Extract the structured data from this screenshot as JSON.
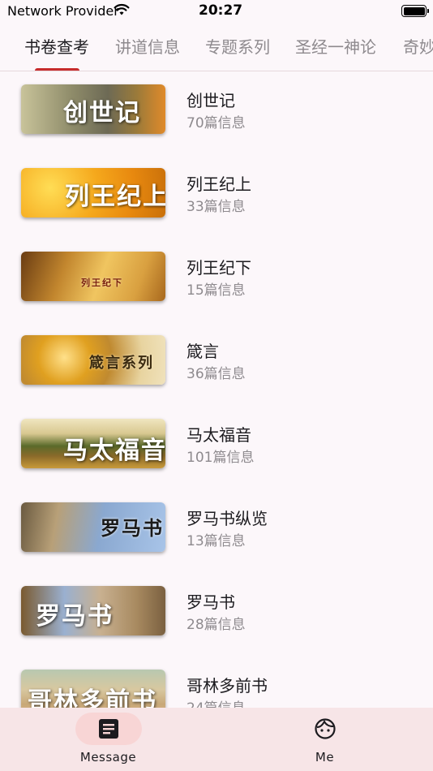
{
  "status_bar": {
    "carrier": "Network Provider",
    "time": "20:27"
  },
  "tabs": [
    {
      "label": "书卷查考",
      "active": true
    },
    {
      "label": "讲道信息"
    },
    {
      "label": "专题系列"
    },
    {
      "label": "圣经一神论"
    },
    {
      "label": "奇妙"
    }
  ],
  "books": [
    {
      "title": "创世记",
      "count": "70篇信息",
      "thumb_text": "创世记"
    },
    {
      "title": "列王纪上",
      "count": "33篇信息",
      "thumb_text": "列王纪上"
    },
    {
      "title": "列王纪下",
      "count": "15篇信息",
      "thumb_text": "列王纪下"
    },
    {
      "title": "箴言",
      "count": "36篇信息",
      "thumb_text": "箴言系列"
    },
    {
      "title": "马太福音",
      "count": "101篇信息",
      "thumb_text": "马太福音"
    },
    {
      "title": "罗马书纵览",
      "count": "13篇信息",
      "thumb_text": "罗马书"
    },
    {
      "title": "罗马书",
      "count": "28篇信息",
      "thumb_text": "罗马书"
    },
    {
      "title": "哥林多前书",
      "count": "24篇信息",
      "thumb_text": "哥林多前书"
    }
  ],
  "bottom_nav": [
    {
      "label": "Message",
      "icon": "message-icon",
      "active": true
    },
    {
      "label": "Me",
      "icon": "face-icon"
    }
  ],
  "colors": {
    "accent": "#c72c2c",
    "background": "#fcf7fa",
    "nav_background": "#f7e5e7",
    "nav_pill": "#f8d5d5"
  }
}
